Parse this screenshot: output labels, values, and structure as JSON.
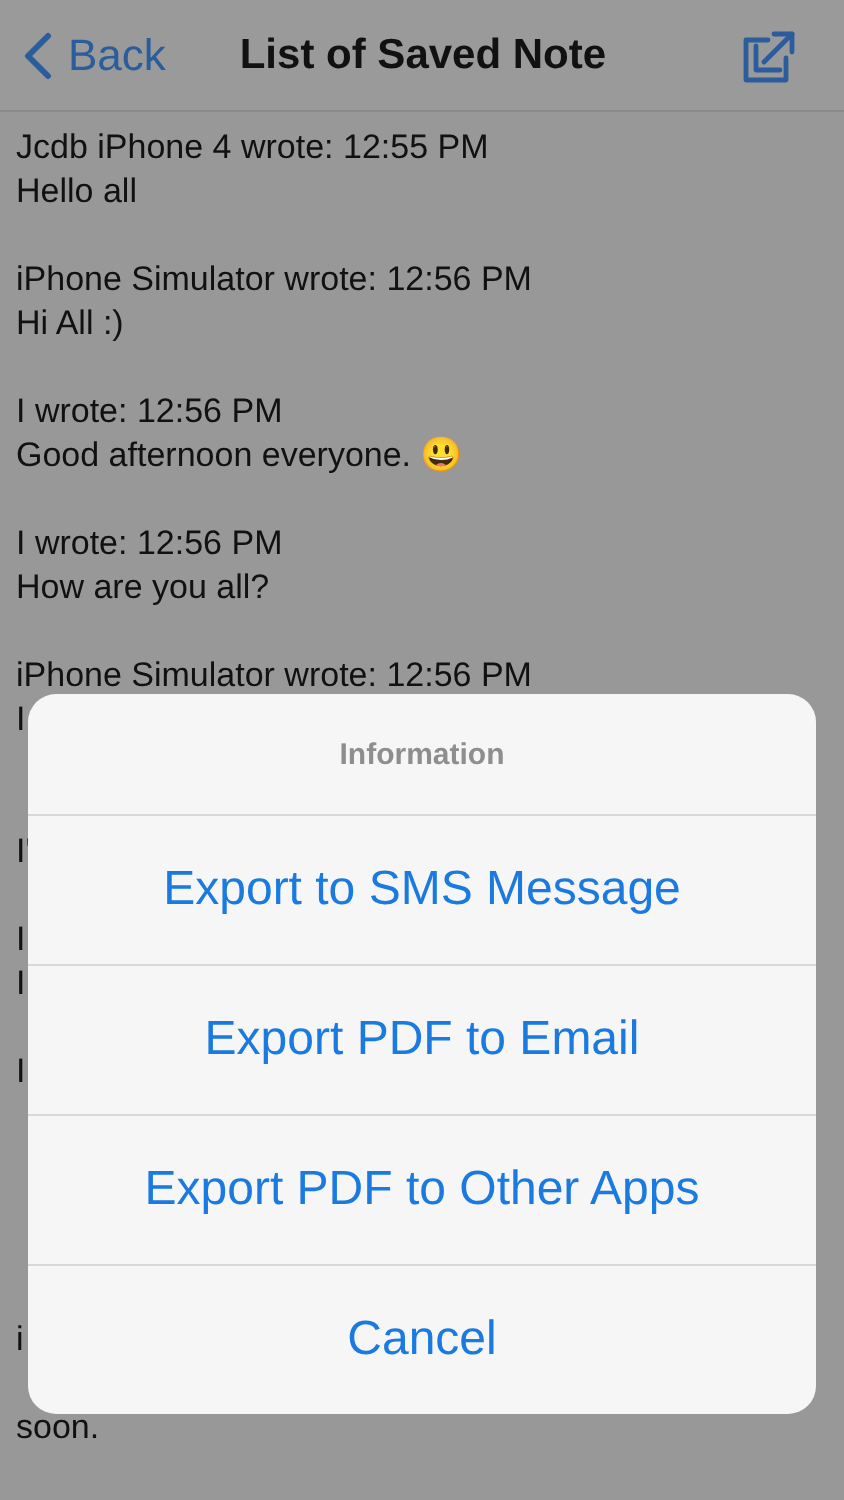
{
  "nav": {
    "back": "Back",
    "title": "List of Saved Note"
  },
  "notes": [
    {
      "header": "Jcdb iPhone 4 wrote: 12:55 PM",
      "body": "Hello all"
    },
    {
      "header": "iPhone Simulator wrote: 12:56 PM",
      "body": "Hi All :)"
    },
    {
      "header": "I wrote: 12:56 PM",
      "body": "Good afternoon everyone. 😃"
    },
    {
      "header": "I wrote: 12:56 PM",
      "body": "How are you all?"
    },
    {
      "header": "iPhone Simulator wrote: 12:56 PM",
      "body": "I"
    },
    {
      "body": "I'"
    },
    {
      "header": "I",
      "body": "I"
    },
    {
      "header": "I"
    },
    {
      "header": "i",
      "continuation": "soon."
    }
  ],
  "sheet": {
    "title": "Information",
    "actions": [
      "Export to SMS Message",
      "Export PDF to Email",
      "Export PDF to Other Apps",
      "Cancel"
    ]
  }
}
